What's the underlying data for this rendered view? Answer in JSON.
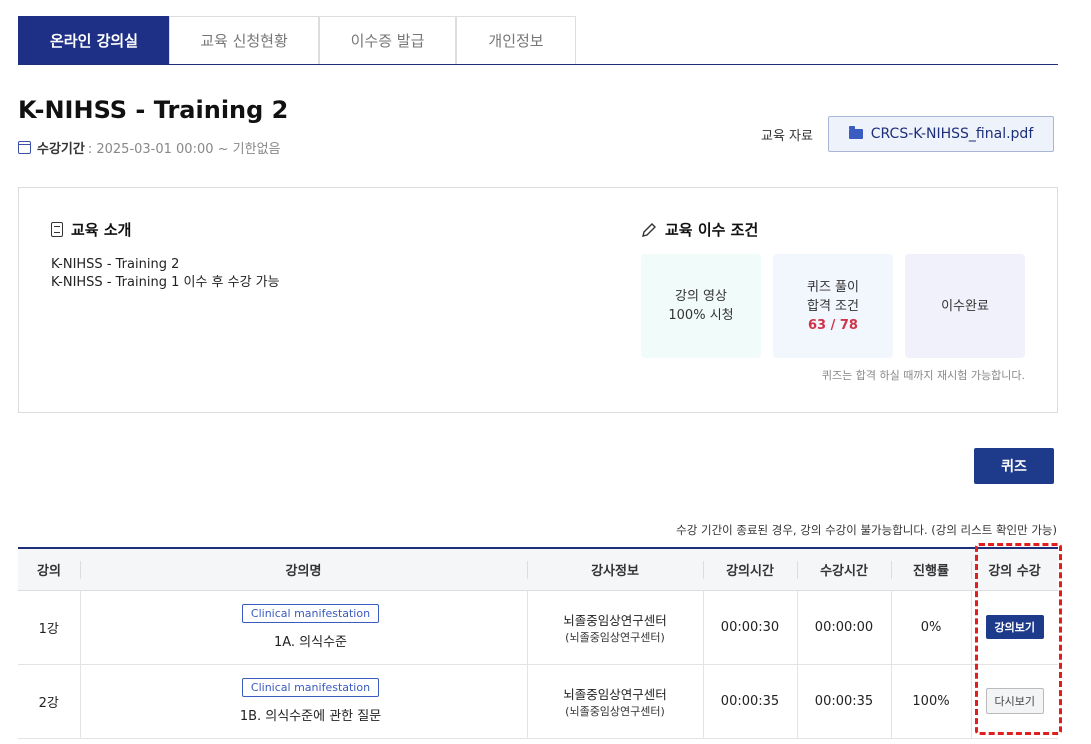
{
  "tabs": [
    {
      "label": "온라인 강의실"
    },
    {
      "label": "교육 신청현황"
    },
    {
      "label": "이수증 발급"
    },
    {
      "label": "개인정보"
    }
  ],
  "course": {
    "title": "K-NIHSS - Training 2",
    "period_label": "수강기간",
    "period_value": ": 2025-03-01 00:00 ~ 기한없음"
  },
  "materials": {
    "label": "교육 자료",
    "file": "CRCS-K-NIHSS_final.pdf"
  },
  "intro": {
    "title": "교육 소개",
    "lines": [
      "K-NIHSS - Training 2",
      "K-NIHSS - Training 1 이수 후 수강 가능"
    ]
  },
  "conditions": {
    "title": "교육 이수 조건",
    "cards": [
      {
        "line1": "강의 영상",
        "line2": "100% 시청",
        "bg": "#f1fbf9"
      },
      {
        "line1": "퀴즈 풀이",
        "line2": "합격 조건",
        "score": "63 / 78",
        "bg": "#f2f6fd"
      },
      {
        "line1": "이수완료",
        "bg": "#f1f1fb"
      }
    ],
    "note": "퀴즈는 합격 하실 때까지 재시험 가능합니다."
  },
  "quiz_button": "퀴즈",
  "notice": "수강 기간이 종료된 경우, 강의 수강이 불가능합니다. (강의 리스트 확인만 가능)",
  "table": {
    "headers": [
      "강의",
      "강의명",
      "강사정보",
      "강의시간",
      "수강시간",
      "진행률",
      "강의 수강"
    ],
    "rows": [
      {
        "no": "1강",
        "tag": "Clinical manifestation",
        "name": "1A. 의식수준",
        "inst_main": "뇌졸중임상연구센터",
        "inst_sub": "(뇌졸중임상연구센터)",
        "duration": "00:00:30",
        "watched": "00:00:00",
        "progress": "0%",
        "action": "강의보기"
      },
      {
        "no": "2강",
        "tag": "Clinical manifestation",
        "name": "1B. 의식수준에 관한 질문",
        "inst_main": "뇌졸중임상연구센터",
        "inst_sub": "(뇌졸중임상연구센터)",
        "duration": "00:00:35",
        "watched": "00:00:35",
        "progress": "100%",
        "action": "다시보기"
      }
    ]
  },
  "colors": {
    "primary": "#1e2f86",
    "highlight": "#e01e1e",
    "score": "#d0344a"
  }
}
